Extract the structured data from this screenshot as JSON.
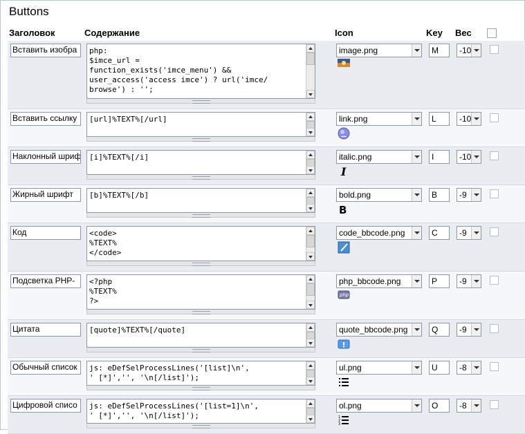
{
  "panel_title": "Buttons",
  "headers": {
    "title": "Заголовок",
    "content": "Содержание",
    "icon": "Icon",
    "key": "Key",
    "weight": "Вес"
  },
  "rows": [
    {
      "title": "Вставить изобра",
      "content": "php:\n$imce_url =\nfunction_exists('imce_menu') &&\nuser_access('access imce') ? url('imce/\nbrowse') : '';",
      "icon": "image.png",
      "icon_name": "image-icon",
      "key": "M",
      "weight": "-10"
    },
    {
      "title": "Вставить ссылку",
      "content": "[url]%TEXT%[/url]",
      "icon": "link.png",
      "icon_name": "link-icon",
      "key": "L",
      "weight": "-10"
    },
    {
      "title": "Наклонный шриф",
      "content": "[i]%TEXT%[/i]",
      "icon": "italic.png",
      "icon_name": "italic-icon",
      "key": "I",
      "weight": "-10"
    },
    {
      "title": "Жирный шрифт",
      "content": "[b]%TEXT%[/b]",
      "icon": "bold.png",
      "icon_name": "bold-icon",
      "key": "B",
      "weight": "-9"
    },
    {
      "title": "Код",
      "content": "<code>\n%TEXT%\n</code>",
      "icon": "code_bbcode.png",
      "icon_name": "code-icon",
      "key": "C",
      "weight": "-9"
    },
    {
      "title": "Подсветка PHP-",
      "content": "<?php\n%TEXT%\n?>",
      "icon": "php_bbcode.png",
      "icon_name": "php-icon",
      "key": "P",
      "weight": "-9"
    },
    {
      "title": "Цитата",
      "content": "[quote]%TEXT%[/quote]",
      "icon": "quote_bbcode.png",
      "icon_name": "quote-icon",
      "key": "Q",
      "weight": "-9"
    },
    {
      "title": "Обычный список",
      "content": "js: eDefSelProcessLines('[list]\\n',\n' [*]','', '\\n[/list]');",
      "icon": "ul.png",
      "icon_name": "unordered-list-icon",
      "key": "U",
      "weight": "-8"
    },
    {
      "title": "Цифровой списо",
      "content": "js: eDefSelProcessLines('[list=1]\\n',\n' [*]','', '\\n[/list]');",
      "icon": "ol.png",
      "icon_name": "ordered-list-icon",
      "key": "O",
      "weight": "-8"
    }
  ]
}
